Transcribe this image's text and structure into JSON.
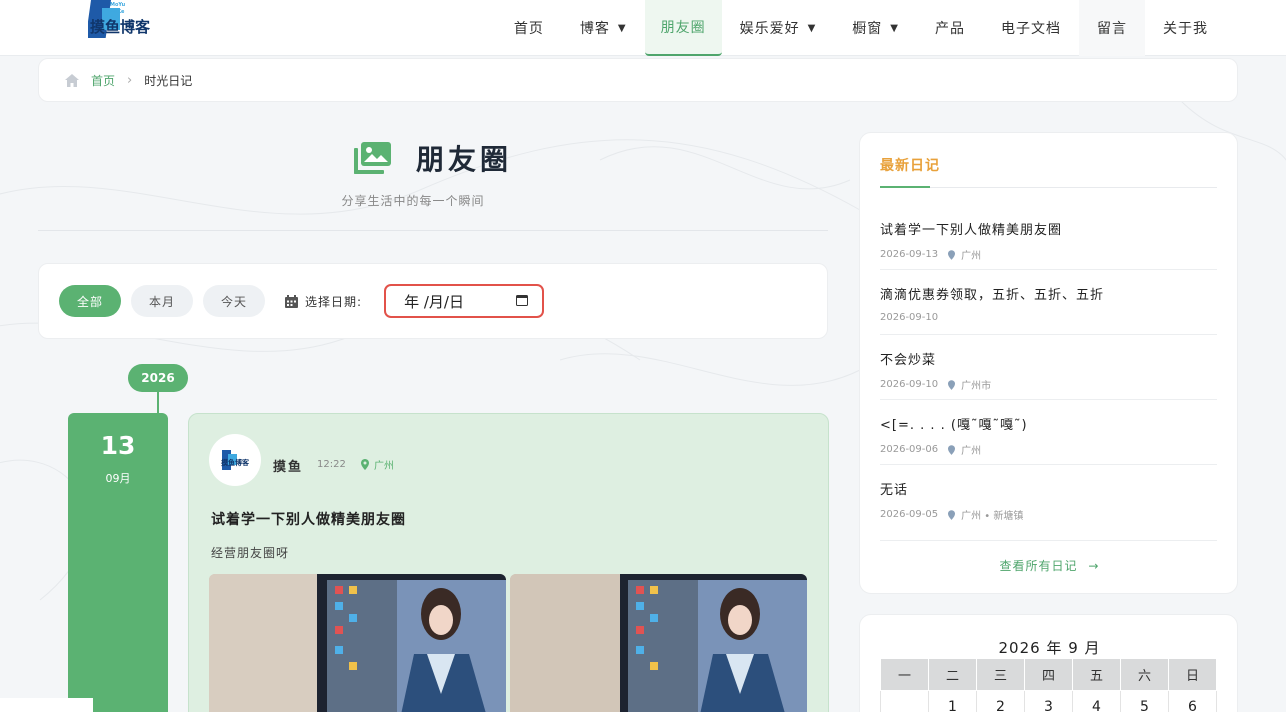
{
  "header": {
    "logo_text_small": "MoYu BoKe",
    "logo_text": "摸鱼博客",
    "nav": [
      {
        "label": "首页",
        "dropdown": false
      },
      {
        "label": "博客",
        "dropdown": true
      },
      {
        "label": "朋友圈",
        "dropdown": false,
        "active": true
      },
      {
        "label": "娱乐爱好",
        "dropdown": true
      },
      {
        "label": "橱窗",
        "dropdown": true
      },
      {
        "label": "产品",
        "dropdown": false
      },
      {
        "label": "电子文档",
        "dropdown": false
      },
      {
        "label": "留言",
        "dropdown": false
      },
      {
        "label": "关于我",
        "dropdown": false
      }
    ]
  },
  "breadcrumb": {
    "home": "首页",
    "current": "时光日记"
  },
  "page": {
    "title": "朋友圈",
    "subtitle": "分享生活中的每一个瞬间"
  },
  "filters": {
    "chips": [
      "全部",
      "本月",
      "今天"
    ],
    "date_label": "选择日期:",
    "date_value": "年 /月/日"
  },
  "timeline": {
    "year": "2026",
    "day": "13",
    "month": "09月",
    "post": {
      "author": "摸鱼",
      "time": "12:22",
      "location": "广州",
      "title": "试着学一下别人做精美朋友圈",
      "text": "经营朋友圈呀"
    }
  },
  "sidebar": {
    "title": "最新日记",
    "items": [
      {
        "title": "试着学一下别人做精美朋友圈",
        "date": "2026-09-13",
        "location": "广州"
      },
      {
        "title": "滴滴优惠券领取，五折、五折、五折",
        "date": "2026-09-10",
        "location": ""
      },
      {
        "title": "不会炒菜",
        "date": "2026-09-10",
        "location": "广州市"
      },
      {
        "title": "<[=. . . . (嘎˜嘎˜嘎˜)",
        "date": "2026-09-06",
        "location": "广州"
      },
      {
        "title": "无话",
        "date": "2026-09-05",
        "location": "广州 • 新塘镇"
      }
    ],
    "see_all": "查看所有日记"
  },
  "calendar": {
    "heading": "2026 年 9 月",
    "weekdays": [
      "一",
      "二",
      "三",
      "四",
      "五",
      "六",
      "日"
    ],
    "first_row": [
      "",
      "1",
      "2",
      "3",
      "4",
      "5",
      "6"
    ]
  },
  "colors": {
    "accent": "#5bb272",
    "orange": "#e8a13b",
    "error": "#e2524a"
  }
}
